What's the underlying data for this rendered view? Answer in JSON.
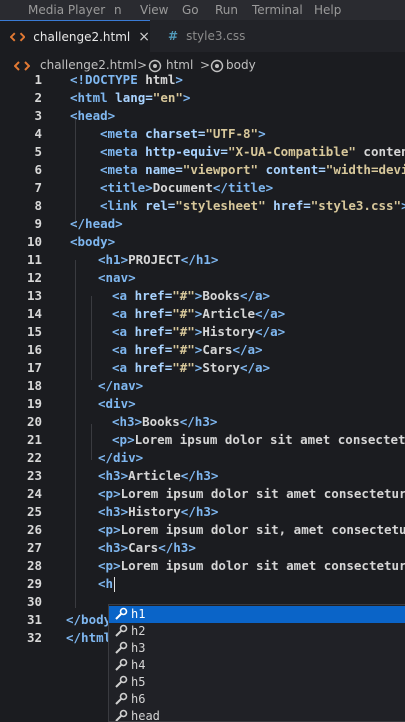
{
  "menubar": {
    "items": [
      "Media Player",
      "n",
      "View",
      "Go",
      "Run",
      "Terminal",
      "Help"
    ]
  },
  "tabs": [
    {
      "icon": "html-file-icon",
      "label": "challenge2.html",
      "close": "×"
    },
    {
      "icon": "css-file-icon",
      "label": "style3.css"
    }
  ],
  "breadcrumb": {
    "file": "challenge2.html",
    "sep": ">",
    "node1": "html",
    "sep2": ">",
    "node2": "body"
  },
  "editor": {
    "lines": [
      {
        "n": "1",
        "text": "<!DOCTYPE html>"
      },
      {
        "n": "2",
        "text": "<html lang=\"en\">"
      },
      {
        "n": "3",
        "text": "<head>"
      },
      {
        "n": "4",
        "text": "<meta charset=\"UTF-8\">"
      },
      {
        "n": "5",
        "text": "<meta http-equiv=\"X-UA-Compatible\" conten"
      },
      {
        "n": "6",
        "text": "<meta name=\"viewport\" content=\"width=devi"
      },
      {
        "n": "7",
        "text": "<title>Document</title>"
      },
      {
        "n": "8",
        "text": "<link rel=\"stylesheet\" href=\"style3.css\">"
      },
      {
        "n": "9",
        "text": "</head>"
      },
      {
        "n": "10",
        "text": "<body>"
      },
      {
        "n": "11",
        "text": "<h1>PROJECT</h1>"
      },
      {
        "n": "12",
        "text": "<nav>"
      },
      {
        "n": "13",
        "text": "<a href=\"#\">Books</a>"
      },
      {
        "n": "14",
        "text": "<a href=\"#\">Article</a>"
      },
      {
        "n": "15",
        "text": "<a href=\"#\">History</a>"
      },
      {
        "n": "16",
        "text": "<a href=\"#\">Cars</a>"
      },
      {
        "n": "17",
        "text": "<a href=\"#\">Story</a>"
      },
      {
        "n": "18",
        "text": "</nav>"
      },
      {
        "n": "19",
        "text": "<div>"
      },
      {
        "n": "20",
        "text": "<h3>Books</h3>"
      },
      {
        "n": "21",
        "text": "<p>Lorem ipsum dolor sit amet consectetu"
      },
      {
        "n": "22",
        "text": "</div>"
      },
      {
        "n": "23",
        "text": "<h3>Article</h3>"
      },
      {
        "n": "24",
        "text": "<p>Lorem ipsum dolor sit amet consectetur"
      },
      {
        "n": "25",
        "text": "<h3>History</h3>"
      },
      {
        "n": "26",
        "text": "<p>Lorem ipsum dolor sit, amet consectetur"
      },
      {
        "n": "27",
        "text": "<h3>Cars</h3>"
      },
      {
        "n": "28",
        "text": "<p>Lorem ipsum dolor sit amet consectetur a"
      },
      {
        "n": "29",
        "text": "<h"
      },
      {
        "n": "30",
        "text": ""
      },
      {
        "n": "31",
        "text": "</body"
      },
      {
        "n": "32",
        "text": "</html"
      }
    ]
  },
  "suggestions": {
    "icon": "wrench-icon",
    "items": [
      "h1",
      "h2",
      "h3",
      "h4",
      "h5",
      "h6",
      "head"
    ]
  }
}
